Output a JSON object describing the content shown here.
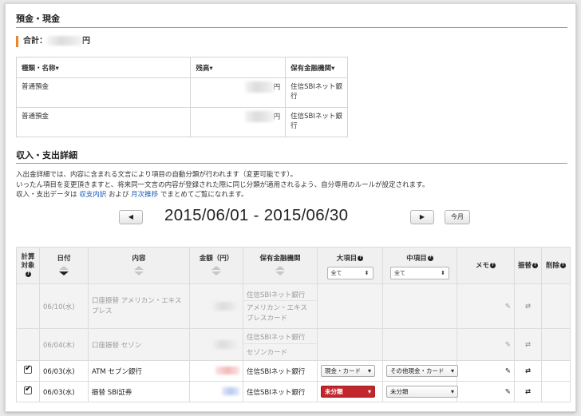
{
  "deposit": {
    "title": "預金・現金",
    "total_label": "合計：",
    "total_unit": "円",
    "columns": [
      "種類・名称▾",
      "残高▾",
      "保有金融機関▾"
    ],
    "accounts": [
      {
        "type": "普通預金",
        "unit": "円",
        "institution": "住信SBIネット銀行"
      },
      {
        "type": "普通預金",
        "unit": "円",
        "institution": "住信SBIネット銀行"
      }
    ]
  },
  "detail": {
    "title": "収入・支出詳細",
    "desc_line1": "入出金詳細では、内容に含まれる文言により項目の自動分類が行われます（変更可能です）。",
    "desc_line2": "いったん項目を変更頂きますと、将来同一文言の内容が登録された際に同じ分類が適用されるよう、自分専用のルールが設定されます。",
    "desc_line3_pre": "収入・支出データは",
    "link_breakdown": "収支内訳",
    "desc_line3_mid": "および",
    "link_monthly": "月次推移",
    "desc_line3_post": "でまとめてご覧になれます。"
  },
  "period": {
    "prev_label": "◀",
    "range": "2015/06/01 - 2015/06/30",
    "next_label": "▶",
    "today_label": "今月"
  },
  "table": {
    "headers": {
      "calc": "計算対象",
      "date": "日付",
      "content": "内容",
      "amount": "金額（円）",
      "institution": "保有金融機関",
      "major": "大項目",
      "middle": "中項目",
      "memo": "メモ",
      "transfer": "振替",
      "delete": "削除"
    },
    "filter_all": "全て",
    "rows": [
      {
        "date": "06/10(水)",
        "content": "口座振替 アメリカン・エキスプレス",
        "inst1": "住信SBIネット銀行",
        "inst2": "アメリカン・エキスプレスカード"
      },
      {
        "date": "06/04(木)",
        "content": "口座振替 セゾン",
        "inst1": "住信SBIネット銀行",
        "inst2": "セゾンカード"
      },
      {
        "date": "06/03(水)",
        "content": "ATM セブン銀行",
        "inst1": "住信SBIネット銀行",
        "major": "現金・カード",
        "middle": "その他現金・カード"
      },
      {
        "date": "06/03(水)",
        "content": "振替 SBI証券",
        "inst1": "住信SBIネット銀行",
        "major": "未分類",
        "middle": "未分類"
      }
    ]
  },
  "colors": {
    "accent": "#e8862b",
    "link": "#1a5cb8",
    "unclassified": "#c1272d"
  }
}
